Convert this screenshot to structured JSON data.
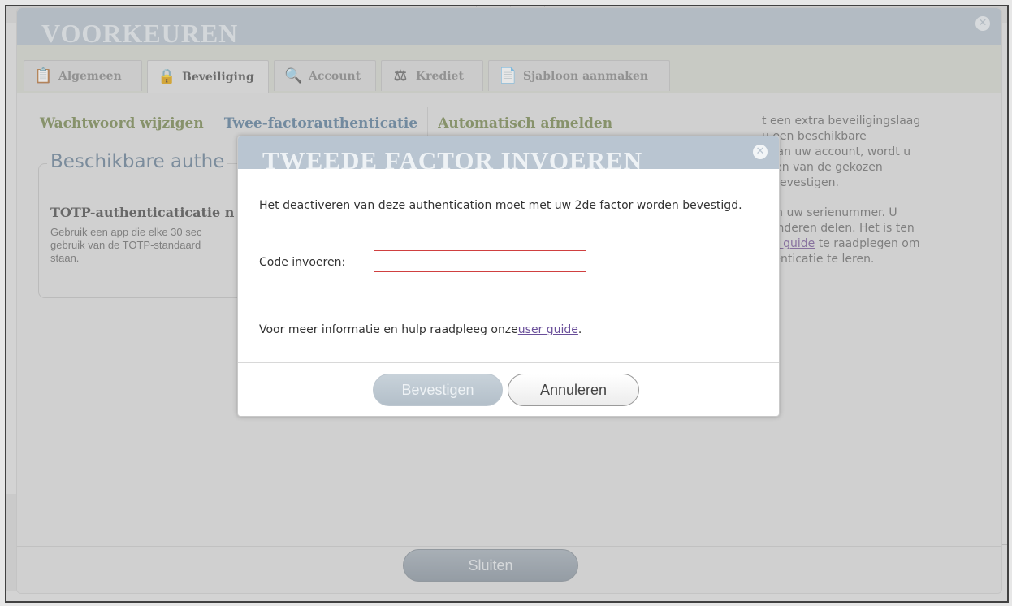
{
  "preferences": {
    "title": "VOORKEUREN",
    "tabs": [
      {
        "label": "Algemeen",
        "icon": "clipboard-icon",
        "active": false
      },
      {
        "label": "Beveiliging",
        "icon": "lock-icon",
        "active": true
      },
      {
        "label": "Account",
        "icon": "user-search-icon",
        "active": false
      },
      {
        "label": "Krediet",
        "icon": "scales-icon",
        "active": false
      },
      {
        "label": "Sjabloon aanmaken",
        "icon": "document-icon",
        "active": false
      }
    ],
    "subnav": [
      {
        "label": "Wachtwoord wijzigen",
        "active": false
      },
      {
        "label": "Twee-factorauthenticatie",
        "active": true
      },
      {
        "label": "Automatisch afmelden",
        "active": false
      }
    ],
    "available_section": {
      "legend": "Beschikbare authe",
      "totp_title": "TOTP-authenticaticatie n",
      "totp_desc_lines": [
        "Gebruik een app die elke 30 sec",
        "gebruik van de TOTP-standaard",
        "staan."
      ]
    },
    "right_info": {
      "para1_lines": [
        "t een extra beveiligingslaag",
        "u een beschikbare",
        "t aan uw account, wordt u",
        "oken van de gekozen",
        "e bevestigen."
      ],
      "para2_lines": [
        "aan uw serienummer. U",
        "t anderen delen. Het is ten"
      ],
      "para2_link": "ser guide",
      "para2_after_link": " te raadplegen om",
      "para2_last": "thenticatie te leren."
    },
    "close_button": "Sluiten"
  },
  "dialog": {
    "title": "TWEEDE FACTOR INVOEREN",
    "message": "Het deactiveren van deze authentication moet met uw 2de factor worden bevestigd.",
    "code_label": "Code invoeren:",
    "code_value": "",
    "help_text": "Voor meer informatie en hulp raadpleeg onze",
    "help_link": "user guide",
    "help_suffix": ".",
    "confirm_button": "Bevestigen",
    "cancel_button": "Annuleren"
  },
  "colors": {
    "header_bg": "#b8c3cd",
    "subnav_green": "#7a8a54",
    "subnav_active": "#5d7e9b",
    "input_error_border": "#d04040",
    "link_purple": "#6a4f9a"
  }
}
